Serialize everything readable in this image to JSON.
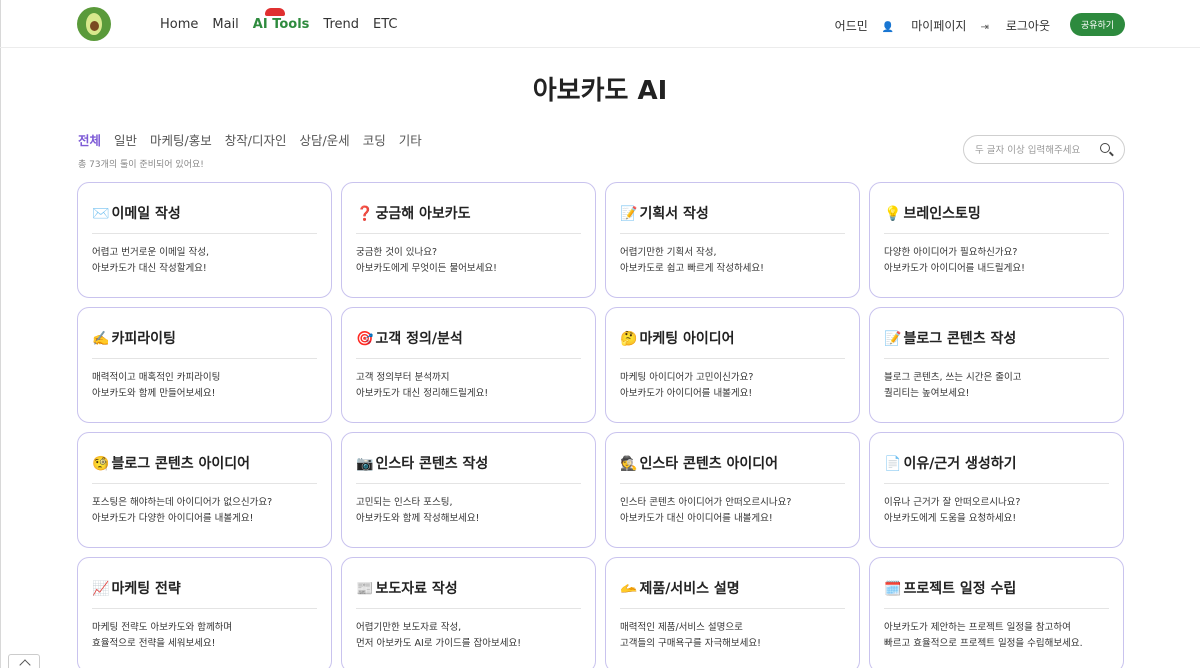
{
  "header": {
    "nav": [
      {
        "label": "Home"
      },
      {
        "label": "Mail"
      },
      {
        "label": "AI Tools"
      },
      {
        "label": "Trend"
      },
      {
        "label": "ETC"
      }
    ],
    "util": {
      "admin": "어드민",
      "mypage": "마이페이지",
      "logout": "로그아웃"
    },
    "share_label": "공유하기"
  },
  "page_title": "아보카도 AI",
  "filters": [
    "전체",
    "일반",
    "마케팅/홍보",
    "창작/디자인",
    "상담/운세",
    "코딩",
    "기타"
  ],
  "count_note": "총 73개의 툴이 준비되어 있어요!",
  "search": {
    "placeholder": "두 글자 이상 입력해주세요",
    "value": ""
  },
  "colors": {
    "accent_purple": "#7d5ad6",
    "brand_green": "#2d8a3e",
    "card_border": "#c9c3ee"
  },
  "cards": [
    {
      "emoji": "✉️",
      "title": "이메일 작성",
      "line1": "어렵고 번거로운 이메일 작성,",
      "line2": "아보카도가 대신 작성할게요!"
    },
    {
      "emoji": "❓",
      "title": "궁금해 아보카도",
      "line1": "궁금한 것이 있나요?",
      "line2": "아보카도에게 무엇이든 물어보세요!"
    },
    {
      "emoji": "📝",
      "title": "기획서 작성",
      "line1": "어렵기만한 기획서 작성,",
      "line2": "아보카도로 쉽고 빠르게 작성하세요!"
    },
    {
      "emoji": "💡",
      "title": "브레인스토밍",
      "line1": "다양한 아이디어가 필요하신가요?",
      "line2": "아보카도가 아이디어를 내드릴게요!"
    },
    {
      "emoji": "✍️",
      "title": "카피라이팅",
      "line1": "매력적이고 매혹적인 카피라이팅",
      "line2": "아보카도와 함께 만들어보세요!"
    },
    {
      "emoji": "🎯",
      "title": "고객 정의/분석",
      "line1": "고객 정의부터 분석까지",
      "line2": "아보카도가 대신 정리해드릴게요!"
    },
    {
      "emoji": "🤔",
      "title": "마케팅 아이디어",
      "line1": "마케팅 아이디어가 고민이신가요?",
      "line2": "아보카도가 아이디어를 내볼게요!"
    },
    {
      "emoji": "📝",
      "title": "블로그 콘텐츠 작성",
      "line1": "블로그 콘텐츠, 쓰는 시간은 줄이고",
      "line2": "퀄리티는 높여보세요!"
    },
    {
      "emoji": "🧐",
      "title": "블로그 콘텐츠 아이디어",
      "line1": "포스팅은 해야하는데 아이디어가 없으신가요?",
      "line2": "아보카도가 다양한 아이디어를 내볼게요!"
    },
    {
      "emoji": "📷",
      "title": "인스타 콘텐츠 작성",
      "line1": "고민되는 인스타 포스팅,",
      "line2": "아보카도와 함께 작성해보세요!"
    },
    {
      "emoji": "🕵️",
      "title": "인스타 콘텐츠 아이디어",
      "line1": "인스타 콘텐츠 아이디어가 안떠오르시나요?",
      "line2": "아보카도가 대신 아이디어를 내볼게요!"
    },
    {
      "emoji": "📄",
      "title": "이유/근거 생성하기",
      "line1": "이유나 근거가 잘 안떠오르시나요?",
      "line2": "아보카도에게 도움을 요청하세요!"
    },
    {
      "emoji": "📈",
      "title": "마케팅 전략",
      "line1": "마케팅 전략도 아보카도와 함께하며",
      "line2": "효율적으로 전략을 세워보세요!"
    },
    {
      "emoji": "📰",
      "title": "보도자료 작성",
      "line1": "어렵기만한 보도자료 작성,",
      "line2": "먼저 아보카도 AI로 가이드를 잡아보세요!"
    },
    {
      "emoji": "🫴",
      "title": "제품/서비스 설명",
      "line1": "매력적인 제품/서비스 설명으로",
      "line2": "고객들의 구매욕구를 자극해보세요!"
    },
    {
      "emoji": "🗓️",
      "title": "프로젝트 일정 수립",
      "line1": "아보카도가 제안하는 프로젝트 일정을 참고하여",
      "line2": "빠르고 효율적으로 프로젝트 일정을 수립해보세요."
    }
  ]
}
